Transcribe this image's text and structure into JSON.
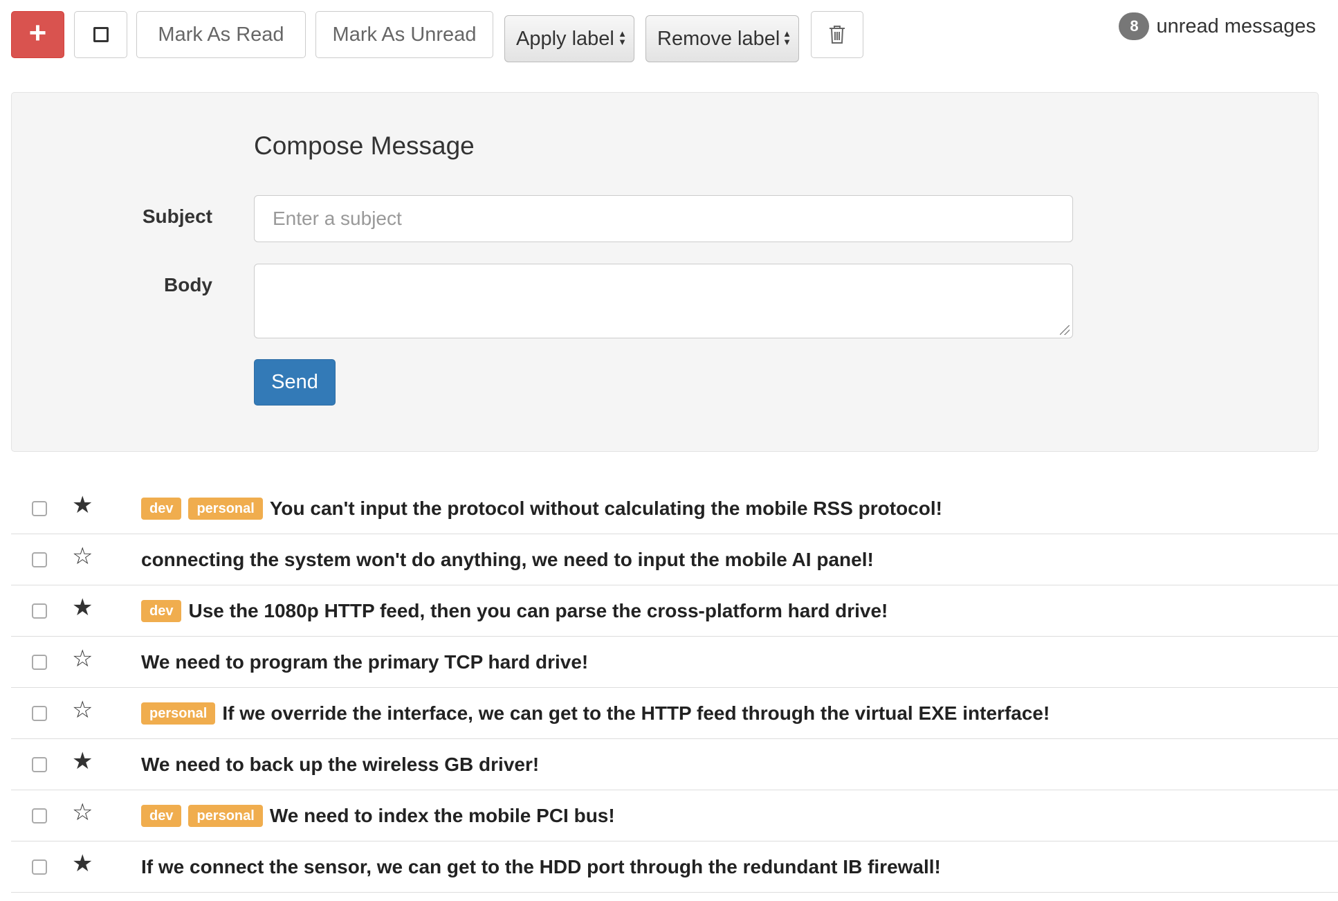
{
  "toolbar": {
    "compose_icon": "plus-icon",
    "select_icon": "checkbox-empty-icon",
    "mark_read": "Mark As Read",
    "mark_unread": "Mark As Unread",
    "apply_label": "Apply label",
    "remove_label": "Remove label",
    "trash_icon": "trash-icon",
    "unread_count": "8",
    "unread_text": "unread messages"
  },
  "compose": {
    "title": "Compose Message",
    "subject_label": "Subject",
    "subject_placeholder": "Enter a subject",
    "body_label": "Body",
    "body_value": "",
    "send_label": "Send"
  },
  "colors": {
    "compose_button": "#d9534f",
    "send_button": "#337ab7",
    "label_tag": "#f0ad4e",
    "badge": "#777777"
  },
  "messages": [
    {
      "starred": true,
      "labels": [
        "dev",
        "personal"
      ],
      "subject": "You can't input the protocol without calculating the mobile RSS protocol!"
    },
    {
      "starred": false,
      "labels": [],
      "subject": "connecting the system won't do anything, we need to input the mobile AI panel!"
    },
    {
      "starred": true,
      "labels": [
        "dev"
      ],
      "subject": "Use the 1080p HTTP feed, then you can parse the cross-platform hard drive!"
    },
    {
      "starred": false,
      "labels": [],
      "subject": "We need to program the primary TCP hard drive!"
    },
    {
      "starred": false,
      "labels": [
        "personal"
      ],
      "subject": "If we override the interface, we can get to the HTTP feed through the virtual EXE interface!"
    },
    {
      "starred": true,
      "labels": [],
      "subject": "We need to back up the wireless GB driver!"
    },
    {
      "starred": false,
      "labels": [
        "dev",
        "personal"
      ],
      "subject": "We need to index the mobile PCI bus!"
    },
    {
      "starred": true,
      "labels": [],
      "subject": "If we connect the sensor, we can get to the HDD port through the redundant IB firewall!"
    }
  ]
}
